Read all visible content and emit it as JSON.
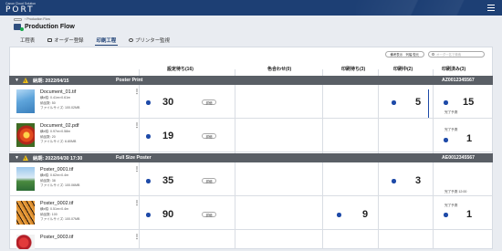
{
  "app": {
    "brand_small": "Canon Cloud Solution",
    "brand": "PORT"
  },
  "breadcrumb": {
    "current": "Production Flow"
  },
  "page": {
    "title": "Production Flow"
  },
  "tabs": [
    {
      "label": "工程表",
      "active": false,
      "icon": "grid-icon"
    },
    {
      "label": "オーダー登録",
      "active": false,
      "icon": "monitor-icon"
    },
    {
      "label": "印刷工程",
      "active": true,
      "icon": "none"
    },
    {
      "label": "プリンター監視",
      "active": false,
      "icon": "gauge-icon"
    }
  ],
  "toolbar": {
    "button_label": "備考表示　列幅 復元",
    "search_placeholder": "オーダー名で検索"
  },
  "columns": [
    "設定待ち(16)",
    "色合わせ(0)",
    "印刷待ち(3)",
    "印刷中(2)",
    "印刷済み(3)"
  ],
  "groups": [
    {
      "due": "納期:  2022/04/15",
      "type": "Poster Print",
      "code": "AZ0012345567",
      "rows": [
        {
          "file": "Document_01.tif",
          "size": "横x縦: 0.41m×0.61m",
          "qty": "納品数: 50",
          "filesize": "ファイルサイズ: 100.02MB",
          "setting": "30",
          "setting_btn": "詳細",
          "printing": "5",
          "done": "15",
          "done_note": "完了予測"
        },
        {
          "file": "Document_02.pdf",
          "size": "横x縦: 0.97m×0.58m",
          "qty": "納品数: 20",
          "filesize": "ファイルサイズ: 6.80MB",
          "setting": "19",
          "setting_btn": "詳細",
          "done": "1",
          "done_note": "完了予測"
        }
      ]
    },
    {
      "due": "納期:  2022/04/30  17:30",
      "type": "Full Size Poster",
      "code": "AE0012345567",
      "rows": [
        {
          "file": "Poster_0001.tif",
          "size": "横x縦: 0.62m×0.4m",
          "qty": "納品数: 38",
          "filesize": "ファイルサイズ: 100.06MB",
          "setting": "35",
          "setting_btn": "詳細",
          "printing": "3",
          "done_note": "完了予測  12:00"
        },
        {
          "file": "Poster_0002.tif",
          "size": "横x縦: 0.51m×0.4m",
          "qty": "納品数: 100",
          "filesize": "ファイルサイズ: 100.07MB",
          "setting": "90",
          "setting_btn": "詳細",
          "waiting": "9",
          "done": "1",
          "done_note": "完了予測"
        },
        {
          "file": "Poster_0003.tif"
        }
      ]
    }
  ],
  "colors": {
    "header": "#1d3f74",
    "group": "#5a5f66",
    "dot": "#1e4aa8",
    "warning": "#f3c318"
  }
}
